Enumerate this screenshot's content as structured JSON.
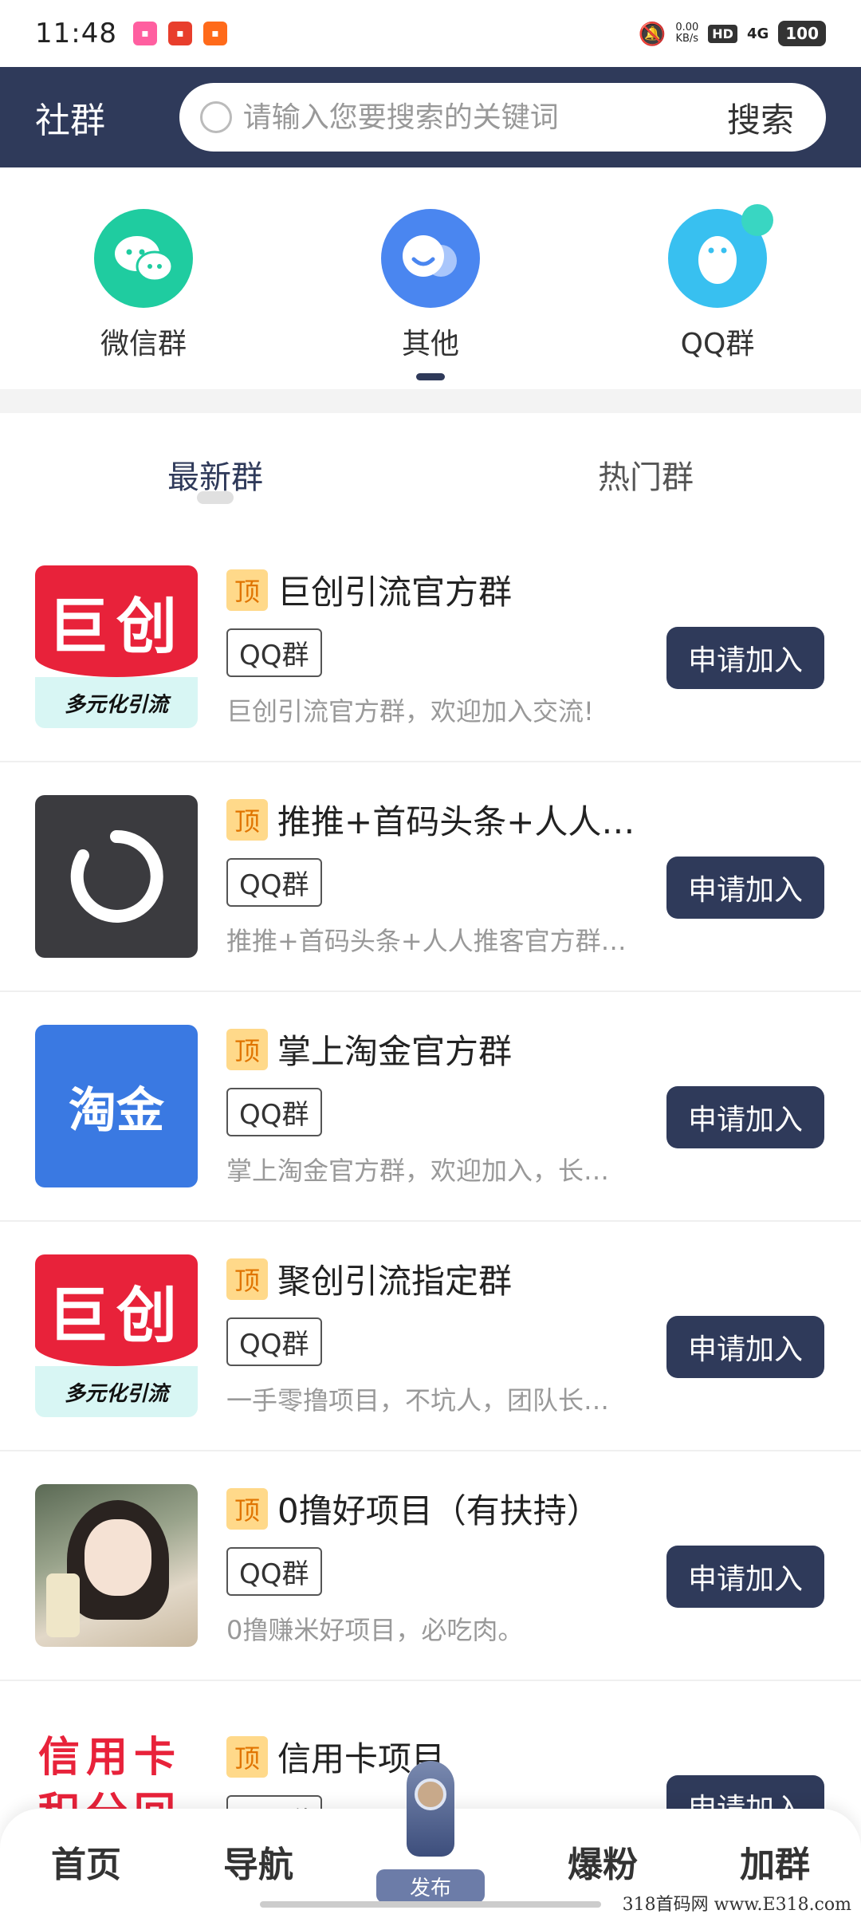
{
  "status_bar": {
    "time": "11:48",
    "net_speed_value": "0.00",
    "net_speed_unit": "KB/s",
    "hd": "HD",
    "network": "4G",
    "battery": "100"
  },
  "header": {
    "title": "社群",
    "search_placeholder": "请输入您要搜索的关键词",
    "search_button": "搜索"
  },
  "categories": [
    {
      "label": "微信群",
      "icon": "wechat-icon",
      "color": "#1fcca0"
    },
    {
      "label": "其他",
      "icon": "people-icon",
      "color": "#4a86f0",
      "active": true
    },
    {
      "label": "QQ群",
      "icon": "qq-penguin-icon",
      "color": "#38c0f0"
    }
  ],
  "subtabs": [
    "最新群",
    "热门群"
  ],
  "groups": [
    {
      "badge": "顶",
      "title": "巨创引流官方群",
      "type": "QQ群",
      "desc": "巨创引流官方群，欢迎加入交流!",
      "action": "申请加入",
      "logo_text": "巨创",
      "logo_sub": "多元化引流"
    },
    {
      "badge": "顶",
      "title": "推推+首码头条+人人…",
      "type": "QQ群",
      "desc": "推推+首码头条+人人推客官方群…",
      "action": "申请加入"
    },
    {
      "badge": "顶",
      "title": "掌上淘金官方群",
      "type": "QQ群",
      "desc": "掌上淘金官方群，欢迎加入，长…",
      "action": "申请加入",
      "logo_text": "淘金"
    },
    {
      "badge": "顶",
      "title": "聚创引流指定群",
      "type": "QQ群",
      "desc": "一手零撸项目，不坑人，团队长…",
      "action": "申请加入",
      "logo_text": "巨创",
      "logo_sub": "多元化引流"
    },
    {
      "badge": "顶",
      "title": "0撸好项目（有扶持）",
      "type": "QQ群",
      "desc": "0撸赚米好项目，必吃肉。",
      "action": "申请加入"
    },
    {
      "badge": "顶",
      "title": "信用卡项目",
      "type": "QQ群",
      "desc": "",
      "action": "申请加入",
      "logo_text": "信用卡",
      "logo_sub": "积分回收"
    }
  ],
  "bottom_nav": {
    "home": "首页",
    "navigate": "导航",
    "publish": "发布",
    "fans": "爆粉",
    "join": "加群"
  },
  "watermark": "318首码网 www.E318.com"
}
